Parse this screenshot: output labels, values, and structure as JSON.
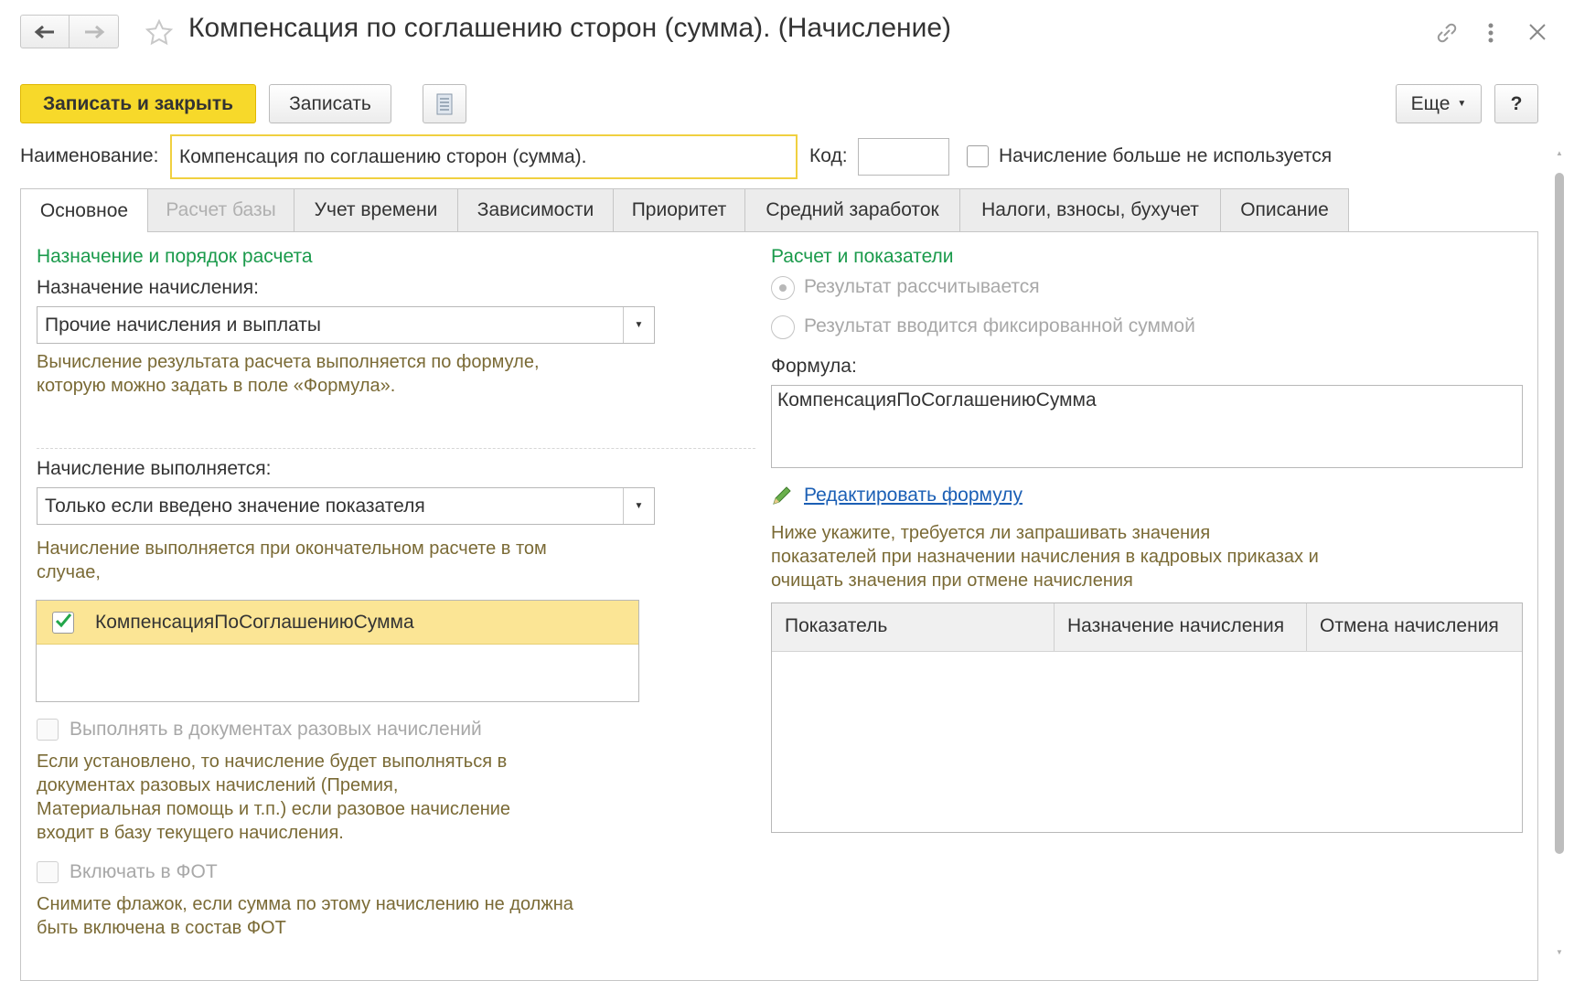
{
  "window": {
    "title": "Компенсация по соглашению сторон (сумма). (Начисление)",
    "nav_back_icon": "arrow-left-icon",
    "nav_forward_icon": "arrow-right-icon",
    "favorite_icon": "star-icon",
    "link_icon": "link-icon",
    "more_icon": "vertical-dots-icon",
    "close_icon": "close-icon"
  },
  "toolbar": {
    "save_close_label": "Записать и закрыть",
    "save_label": "Записать",
    "report_icon": "document-icon",
    "more_label": "Еще",
    "help_label": "?"
  },
  "header_fields": {
    "name_label": "Наименование:",
    "name_value": "Компенсация по соглашению сторон (сумма).",
    "code_label": "Код:",
    "code_value": "",
    "unused_label": "Начисление больше не используется",
    "unused_checked": false
  },
  "tabs": [
    {
      "label": "Основное",
      "state": "active"
    },
    {
      "label": "Расчет базы",
      "state": "disabled"
    },
    {
      "label": "Учет времени",
      "state": "normal"
    },
    {
      "label": "Зависимости",
      "state": "normal"
    },
    {
      "label": "Приоритет",
      "state": "normal"
    },
    {
      "label": "Средний заработок",
      "state": "normal"
    },
    {
      "label": "Налоги, взносы, бухучет",
      "state": "normal"
    },
    {
      "label": "Описание",
      "state": "normal"
    }
  ],
  "left": {
    "section_title": "Назначение и порядок расчета",
    "purpose_label": "Назначение начисления:",
    "purpose_value": "Прочие начисления и выплаты",
    "purpose_hint_1": "Вычисление результата расчета выполняется по формуле,",
    "purpose_hint_2": "которую можно задать в поле «Формула».",
    "exec_label": "Начисление выполняется:",
    "exec_value": "Только если введено значение показателя",
    "exec_hint_1": "Начисление выполняется при окончательном расчете в том",
    "exec_hint_2": "случае,",
    "indicator_list": [
      {
        "label": "КомпенсацияПоСоглашениюСумма",
        "checked": true
      }
    ],
    "onetime_label": "Выполнять в документах разовых начислений",
    "onetime_hint_1": "Если установлено, то начисление будет выполняться в",
    "onetime_hint_2": "документах разовых начислений (Премия,",
    "onetime_hint_3": "Материальная помощь и т.п.) если разовое начисление",
    "onetime_hint_4": "входит в базу текущего начисления.",
    "fot_label": "Включать в ФОТ",
    "fot_hint_1": "Снимите флажок, если сумма по этому начислению не должна",
    "fot_hint_2": "быть включена в состав ФОТ"
  },
  "right": {
    "section_title": "Расчет и показатели",
    "radio_calculated": "Результат рассчитывается",
    "radio_fixed": "Результат вводится фиксированной суммой",
    "formula_label": "Формула:",
    "formula_value": "КомпенсацияПоСоглашениюСумма",
    "edit_formula_link": "Редактировать формулу",
    "edit_icon": "pencil-icon",
    "table_hint_1": "Ниже укажите, требуется ли запрашивать значения",
    "table_hint_2": "показателей при назначении начисления в кадровых приказах и",
    "table_hint_3": "очищать значения при отмене начисления",
    "table_columns": [
      "Показатель",
      "Назначение начисления",
      "Отмена начисления"
    ]
  },
  "colors": {
    "primary_button": "#f7d92a",
    "section_title": "#1a9a4b",
    "hint_text": "#7a6a35",
    "link": "#1b5fb5",
    "selected_row": "#fbe595"
  }
}
